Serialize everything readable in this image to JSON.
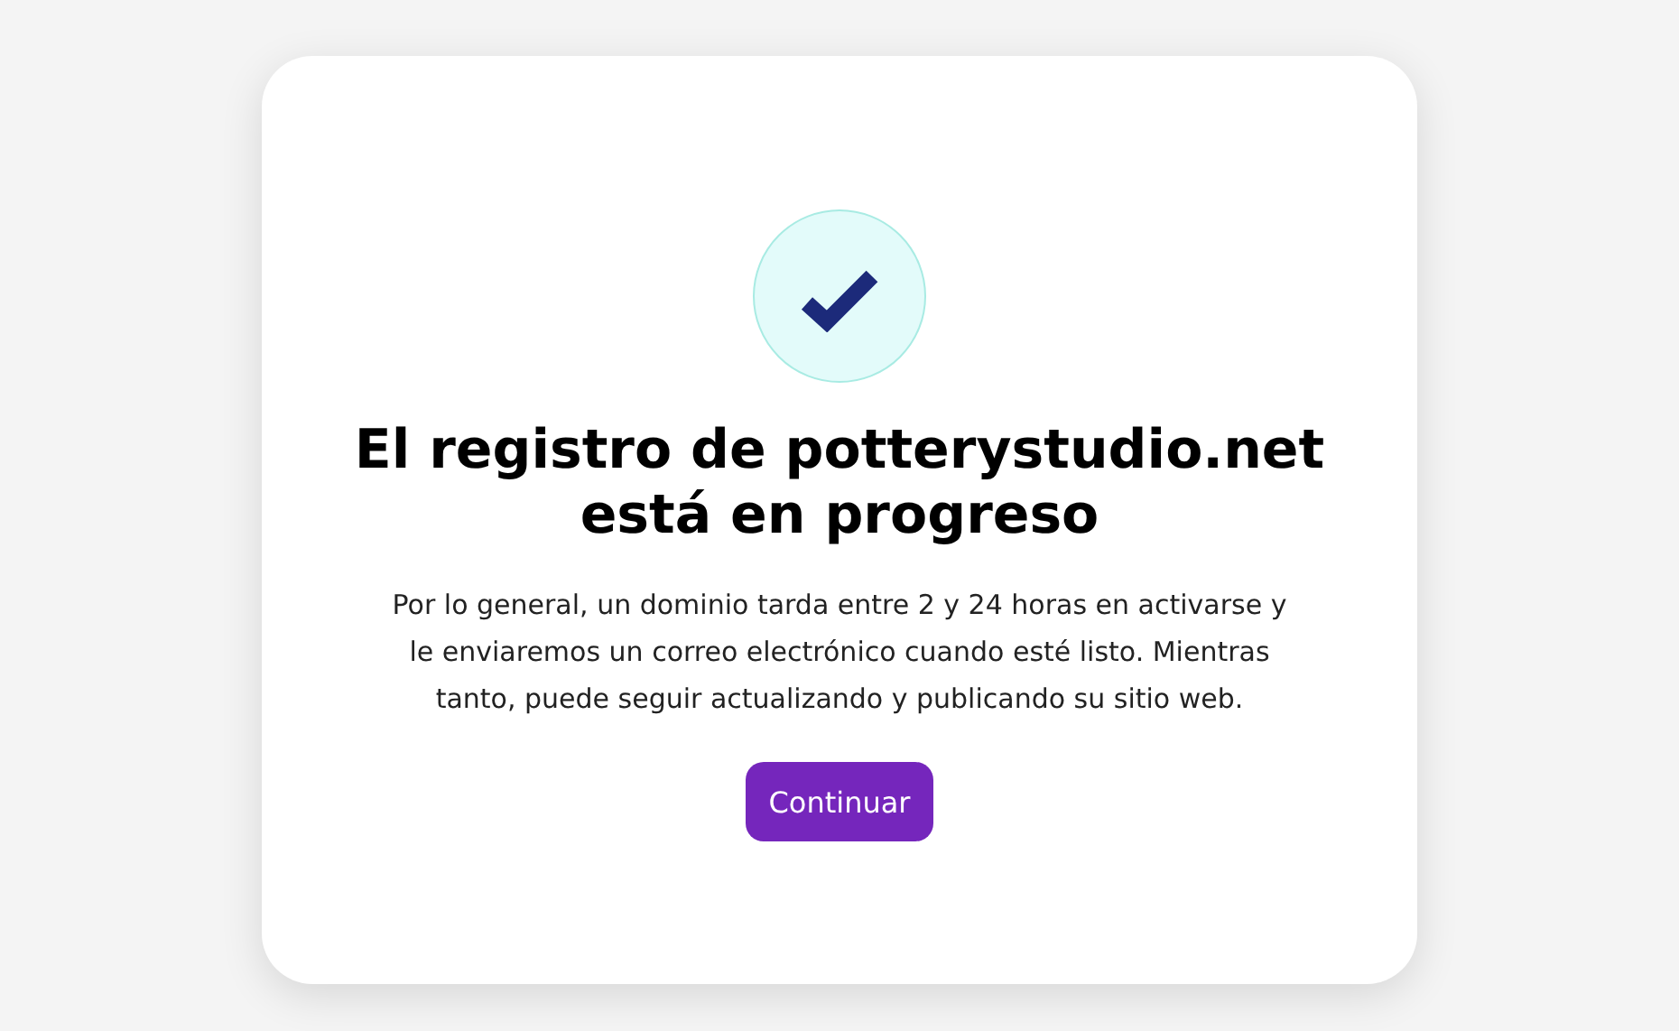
{
  "dialog": {
    "title": "El registro de potterystudio.net está en progreso",
    "message": "Por lo general, un dominio tarda entre 2 y 24 horas en activarse y le enviaremos un correo electrónico cuando esté listo. Mientras tanto, puede seguir actualizando y publicando su sitio web.",
    "button": "Continuar"
  }
}
